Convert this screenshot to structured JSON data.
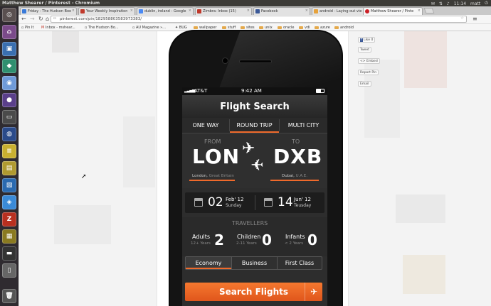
{
  "window": {
    "title": "Matthew Shearer / Pinterest - Chromium",
    "time": "11:14",
    "user": "matt"
  },
  "tabs": [
    {
      "label": "Friday - The Hudson Boo",
      "color": "#3a7ad9"
    },
    {
      "label": "Your Weekly Inspiration",
      "color": "#c0392b"
    },
    {
      "label": "dublin, ireland - Google",
      "color": "#4a8af4"
    },
    {
      "label": "Zimbra: Inbox (15)",
      "color": "#c0392b"
    },
    {
      "label": "Facebook",
      "color": "#3b5998"
    },
    {
      "label": "android - Laying out vie",
      "color": "#e6a23c"
    },
    {
      "label": "Matthew Shearer / Pinte",
      "color": "#cb2027"
    }
  ],
  "toolbar": {
    "url": "pinterest.com/pin/182958803583973383/"
  },
  "bookmarks": [
    "Pin It",
    "Inbox - mshear...",
    "The Hudson Bo...",
    "AU Magazine »...",
    "BUG",
    "wallpaper",
    "stuff",
    "sites",
    "unix",
    "oracle",
    "vdi",
    "azure",
    "android"
  ],
  "share": {
    "like": "Like",
    "like_count": "0",
    "tweet": "Tweet",
    "embed": "<> Embed",
    "report": "Report Pin",
    "email": "Email"
  },
  "app": {
    "carrier": "AT&T",
    "time": "9:42 AM",
    "title": "Flight Search",
    "trip_tabs": [
      "ONE WAY",
      "ROUND TRIP",
      "MULTI CITY"
    ],
    "active_trip": "ROUND TRIP",
    "from_label": "FROM",
    "to_label": "TO",
    "from_code": "LON",
    "to_code": "DXB",
    "from_city": "London,",
    "from_country": "Great Britain",
    "to_city": "Dubai,",
    "to_country": "U.A.E.",
    "depart": {
      "day": "02",
      "month": "Feb' 12",
      "weekday": "Sunday"
    },
    "return": {
      "day": "14",
      "month": "Jun' 12",
      "weekday": "Teusday"
    },
    "travellers_label": "TRAVELLERS",
    "adults": {
      "label": "Adults",
      "sub": "12+ Years",
      "count": "2"
    },
    "children": {
      "label": "Children",
      "sub": "2-11 Years",
      "count": "0"
    },
    "infants": {
      "label": "Infants",
      "sub": "< 2 Years",
      "count": "0"
    },
    "classes": [
      "Economy",
      "Business",
      "First Class"
    ],
    "active_class": "Economy",
    "search_label": "Search Flights"
  },
  "colors": {
    "accent": "#f06a2b"
  }
}
